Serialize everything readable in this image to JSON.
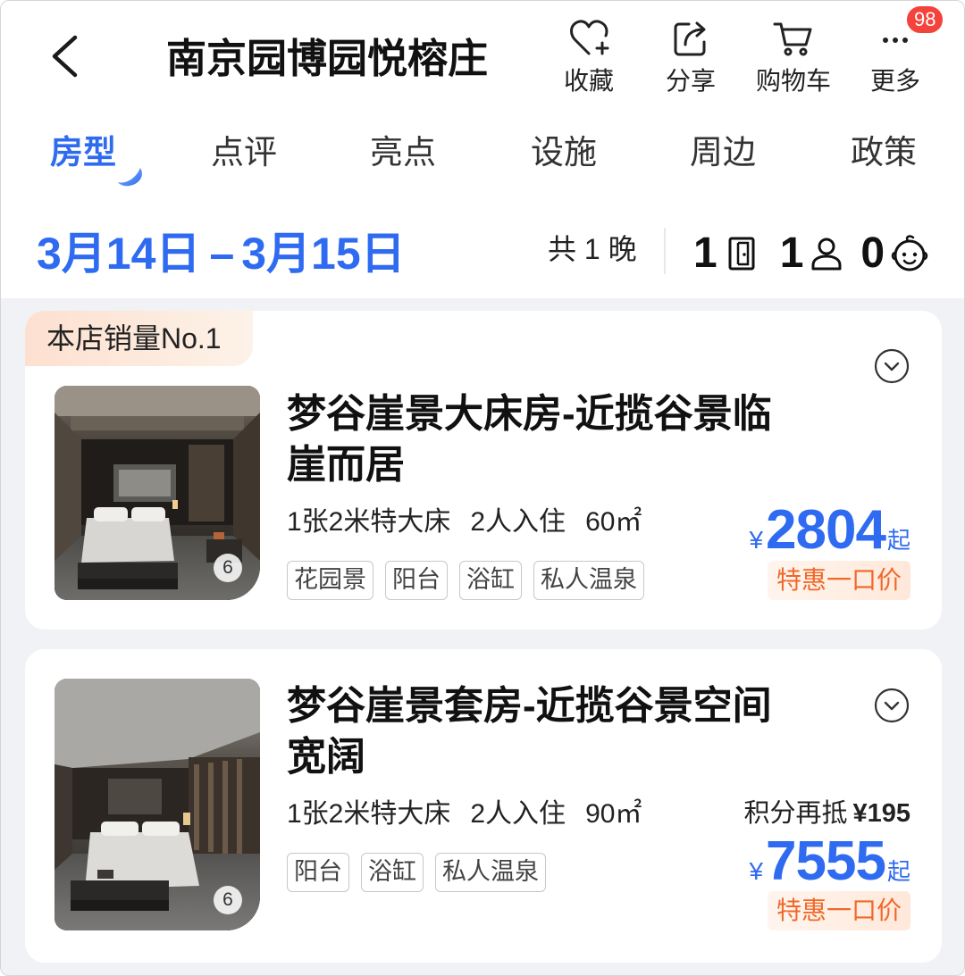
{
  "header": {
    "back_icon": "chevron-left-icon",
    "title": "南京园博园悦榕庄",
    "actions": [
      {
        "label": "收藏",
        "icon": "heart-plus-icon"
      },
      {
        "label": "分享",
        "icon": "share-icon"
      },
      {
        "label": "购物车",
        "icon": "cart-icon"
      },
      {
        "label": "更多",
        "icon": "more-icon",
        "badge": "98"
      }
    ]
  },
  "tabs": [
    {
      "label": "房型",
      "active": true
    },
    {
      "label": "点评",
      "active": false
    },
    {
      "label": "亮点",
      "active": false
    },
    {
      "label": "设施",
      "active": false
    },
    {
      "label": "周边",
      "active": false
    },
    {
      "label": "政策",
      "active": false
    }
  ],
  "stay": {
    "checkin": "3月14日",
    "separator": "–",
    "checkout": "3月15日",
    "nights": "共 1 晚",
    "rooms": "1",
    "rooms_icon": "door-icon",
    "adults": "1",
    "adults_icon": "adult-icon",
    "children": "0",
    "children_icon": "child-icon"
  },
  "rooms": [
    {
      "badge": "本店销量No.1",
      "name": "梦谷崖景大床房-近揽谷景临崖而居",
      "bed": "1张2米特大床",
      "guests": "2人入住",
      "area": "60㎡",
      "tags": [
        "花园景",
        "阳台",
        "浴缸",
        "私人温泉"
      ],
      "photo_count": "6",
      "currency": "¥",
      "price": "2804",
      "price_suffix": "起",
      "deal_label": "特惠一口价",
      "expand_icon": "chevron-down-circle-icon"
    },
    {
      "name": "梦谷崖景套房-近揽谷景空间宽阔",
      "bed": "1张2米特大床",
      "guests": "2人入住",
      "area": "90㎡",
      "tags": [
        "阳台",
        "浴缸",
        "私人温泉"
      ],
      "photo_count": "6",
      "points_label": "积分再抵",
      "points_value": "¥195",
      "currency": "¥",
      "price": "7555",
      "price_suffix": "起",
      "deal_label": "特惠一口价",
      "expand_icon": "chevron-down-circle-icon"
    }
  ],
  "colors": {
    "accent_blue": "#2f6bf0",
    "deal_orange": "#f0682a",
    "badge_red": "#f3433b",
    "page_bg": "#f1f2f5"
  }
}
